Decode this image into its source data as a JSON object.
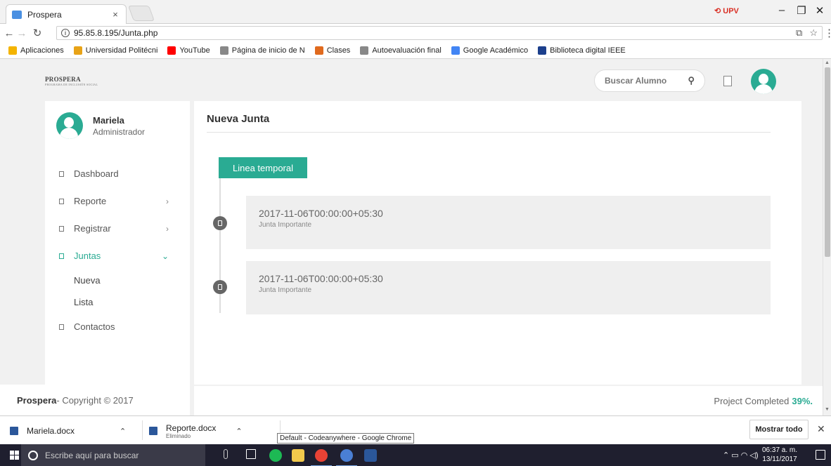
{
  "browser": {
    "tab_title": "Prospera",
    "tab_close": "×",
    "profile_badge": "⟲ UPV",
    "url": "95.85.8.195/Junta.php",
    "bookmarks": [
      {
        "label": "Aplicaciones",
        "color": "#f4b400",
        "icon": "apps-icon"
      },
      {
        "label": "Universidad Politécni",
        "color": "#e8a317",
        "icon": "university-icon"
      },
      {
        "label": "YouTube",
        "color": "#ff0000",
        "icon": "youtube-icon"
      },
      {
        "label": "Página de inicio de N",
        "color": "#888888",
        "icon": "page-icon"
      },
      {
        "label": "Clases",
        "color": "#e06a1e",
        "icon": "classroom-icon"
      },
      {
        "label": "Autoevaluación final",
        "color": "#888888",
        "icon": "star-icon"
      },
      {
        "label": "Google Académico",
        "color": "#4285f4",
        "icon": "scholar-icon"
      },
      {
        "label": "Biblioteca digital IEEE",
        "color": "#1c3f8c",
        "icon": "ieee-icon"
      }
    ]
  },
  "app": {
    "logo": "PROSPERA",
    "logo_sub": "PROGRAMA DE INCLUSIÓN SOCIAL",
    "search_placeholder": "Buscar Alumno",
    "user": {
      "name": "Mariela",
      "role": "Administrador"
    },
    "menu": [
      {
        "label": "Dashboard",
        "chevron": ""
      },
      {
        "label": "Reporte",
        "chevron": "›"
      },
      {
        "label": "Registrar",
        "chevron": "›"
      },
      {
        "label": "Juntas",
        "chevron": "⌄",
        "active": true
      }
    ],
    "submenu": [
      "Nueva",
      "Lista"
    ],
    "menu_last": "Contactos",
    "page_title": "Nueva Junta",
    "timeline_badge": "Linea temporal",
    "timeline": [
      {
        "date": "2017-11-06T00:00:00+05:30",
        "desc": "Junta Importante"
      },
      {
        "date": "2017-11-06T00:00:00+05:30",
        "desc": "Junta Importante"
      }
    ],
    "footer_brand": "Prospera",
    "footer_copy": " - Copyright © 2017",
    "progress_label": "Project Completed",
    "progress_value": "39%."
  },
  "downloads": [
    {
      "name": "Mariela.docx",
      "sub": ""
    },
    {
      "name": "Reporte.docx",
      "sub": "Eliminado"
    }
  ],
  "tooltip": "Default - Codeanywhere - Google Chrome",
  "show_all": "Mostrar todo",
  "taskbar": {
    "search_placeholder": "Escribe aquí para buscar",
    "time": "06:37 a. m.",
    "date": "13/11/2017"
  }
}
